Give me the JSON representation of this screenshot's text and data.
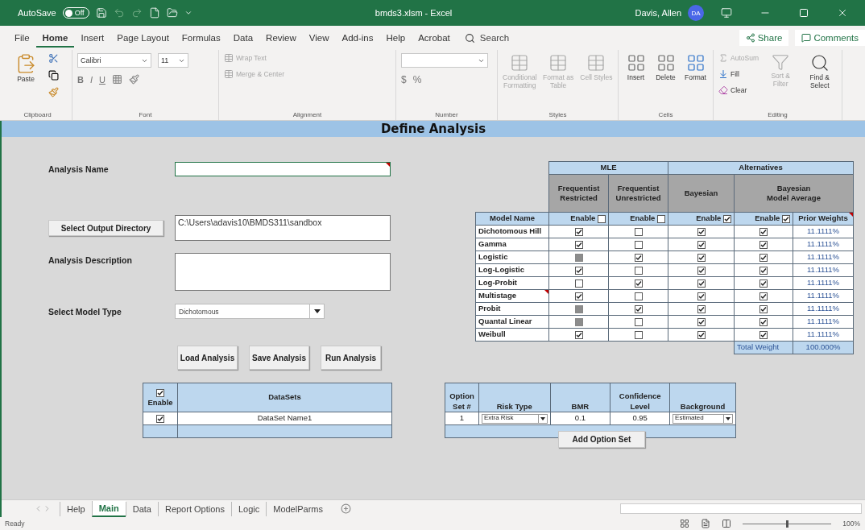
{
  "title_bar": {
    "autosave_label": "AutoSave",
    "autosave_state": "Off",
    "autosave_on": false,
    "file_name": "bmds3.xlsm - Excel",
    "user_name": "Davis, Allen",
    "user_initials": "DA"
  },
  "menu_tabs": [
    {
      "label": "File",
      "selected": false
    },
    {
      "label": "Home",
      "selected": true
    },
    {
      "label": "Insert",
      "selected": false
    },
    {
      "label": "Page Layout",
      "selected": false
    },
    {
      "label": "Formulas",
      "selected": false
    },
    {
      "label": "Data",
      "selected": false
    },
    {
      "label": "Review",
      "selected": false
    },
    {
      "label": "View",
      "selected": false
    },
    {
      "label": "Add-ins",
      "selected": false
    },
    {
      "label": "Help",
      "selected": false
    },
    {
      "label": "Acrobat",
      "selected": false
    }
  ],
  "search": {
    "placeholder": "Search"
  },
  "share": "Share",
  "comments": "Comments",
  "ribbon": {
    "clipboard": {
      "label": "Clipboard",
      "paste": "Paste"
    },
    "font": {
      "label": "Font",
      "font_name": "Calibri",
      "font_size": "11",
      "format_buttons": [
        "B",
        "I",
        "U"
      ]
    },
    "alignment": {
      "label": "Alignment",
      "items": [
        {
          "label": "Wrap Text",
          "disabled": true
        },
        {
          "label": "Merge & Center",
          "disabled": true
        }
      ]
    },
    "number": {
      "label": "Number",
      "symbols": [
        "$",
        "%"
      ]
    },
    "styles": {
      "label": "Styles",
      "items": [
        {
          "label": "Conditional Formatting",
          "disabled": true
        },
        {
          "label": "Format as Table",
          "disabled": true
        },
        {
          "label": "Cell Styles",
          "disabled": true
        }
      ]
    },
    "cells": {
      "label": "Cells",
      "items": [
        "Insert",
        "Delete",
        "Format"
      ]
    },
    "editing": {
      "label": "Editing",
      "items": [
        {
          "label": "AutoSum",
          "disabled": true
        },
        {
          "label": "Fill",
          "disabled": false
        },
        {
          "label": "Clear",
          "disabled": false
        }
      ],
      "large_items": [
        {
          "label": "Sort & Filter",
          "disabled": true
        },
        {
          "label": "Find & Select",
          "disabled": false
        }
      ]
    }
  },
  "sheet": {
    "header": "Define Analysis",
    "analysis_name_label": "Analysis Name",
    "output_button": "Select Output Directory",
    "output_path": "C:\\Users\\adavis10\\BMDS311\\sandbox",
    "description_label": "Analysis Description",
    "model_type_label": "Select Model Type",
    "model_type_value": "Dichotomous",
    "actions": [
      "Load Analysis",
      "Save Analysis",
      "Run Analysis"
    ],
    "models": {
      "groups": [
        "MLE",
        "Alternatives"
      ],
      "methods": [
        "Frequentist\nRestricted",
        "Frequentist\nUnrestricted",
        "Bayesian",
        "Bayesian\nModel Average"
      ],
      "name_header": "Model Name",
      "enable_headers": [
        {
          "label": "Enable",
          "checked": false
        },
        {
          "label": "Enable",
          "checked": false
        },
        {
          "label": "Enable",
          "checked": true
        },
        {
          "label": "Enable",
          "checked": true
        }
      ],
      "weights_header": "Prior Weights",
      "weights_comment": true,
      "rows": [
        {
          "name": "Dichotomous Hill",
          "comment": false,
          "cells": [
            {
              "checked": true,
              "disabled": false
            },
            {
              "checked": false,
              "disabled": false
            },
            {
              "checked": true,
              "disabled": false
            },
            {
              "checked": true,
              "disabled": false
            }
          ],
          "weight": "11.1111%"
        },
        {
          "name": "Gamma",
          "comment": false,
          "cells": [
            {
              "checked": true,
              "disabled": false
            },
            {
              "checked": false,
              "disabled": false
            },
            {
              "checked": true,
              "disabled": false
            },
            {
              "checked": true,
              "disabled": false
            }
          ],
          "weight": "11.1111%"
        },
        {
          "name": "Logistic",
          "comment": false,
          "cells": [
            {
              "checked": false,
              "disabled": true
            },
            {
              "checked": true,
              "disabled": false
            },
            {
              "checked": true,
              "disabled": false
            },
            {
              "checked": true,
              "disabled": false
            }
          ],
          "weight": "11.1111%"
        },
        {
          "name": "Log-Logistic",
          "comment": false,
          "cells": [
            {
              "checked": true,
              "disabled": false
            },
            {
              "checked": false,
              "disabled": false
            },
            {
              "checked": true,
              "disabled": false
            },
            {
              "checked": true,
              "disabled": false
            }
          ],
          "weight": "11.1111%"
        },
        {
          "name": "Log-Probit",
          "comment": false,
          "cells": [
            {
              "checked": false,
              "disabled": false
            },
            {
              "checked": true,
              "disabled": false
            },
            {
              "checked": true,
              "disabled": false
            },
            {
              "checked": true,
              "disabled": false
            }
          ],
          "weight": "11.1111%"
        },
        {
          "name": "Multistage",
          "comment": true,
          "cells": [
            {
              "checked": true,
              "disabled": false
            },
            {
              "checked": false,
              "disabled": false
            },
            {
              "checked": true,
              "disabled": false
            },
            {
              "checked": true,
              "disabled": false
            }
          ],
          "weight": "11.1111%"
        },
        {
          "name": "Probit",
          "comment": false,
          "cells": [
            {
              "checked": false,
              "disabled": true
            },
            {
              "checked": true,
              "disabled": false
            },
            {
              "checked": true,
              "disabled": false
            },
            {
              "checked": true,
              "disabled": false
            }
          ],
          "weight": "11.1111%"
        },
        {
          "name": "Quantal Linear",
          "comment": false,
          "cells": [
            {
              "checked": false,
              "disabled": true
            },
            {
              "checked": false,
              "disabled": false
            },
            {
              "checked": true,
              "disabled": false
            },
            {
              "checked": true,
              "disabled": false
            }
          ],
          "weight": "11.1111%"
        },
        {
          "name": "Weibull",
          "comment": false,
          "cells": [
            {
              "checked": true,
              "disabled": false
            },
            {
              "checked": false,
              "disabled": false
            },
            {
              "checked": true,
              "disabled": false
            },
            {
              "checked": true,
              "disabled": false
            }
          ],
          "weight": "11.1111%"
        }
      ],
      "total_label": "Total Weight",
      "total_value": "100.000%"
    },
    "datasets": {
      "enable_label": "Enable",
      "enable_all": true,
      "header": "DataSets",
      "rows": [
        {
          "enabled": true,
          "name": "DataSet Name1"
        }
      ]
    },
    "options": {
      "columns": [
        "Option\nSet #",
        "Risk Type",
        "BMR",
        "Confidence\nLevel",
        "Background"
      ],
      "rows": [
        {
          "set": "1",
          "risk_type": "Extra Risk",
          "bmr": "0.1",
          "confidence": "0.95",
          "background": "Estimated"
        }
      ],
      "add_button": "Add Option Set"
    }
  },
  "sheet_tabs": [
    {
      "label": "Help",
      "selected": false
    },
    {
      "label": "Main",
      "selected": true
    },
    {
      "label": "Data",
      "selected": false
    },
    {
      "label": "Report Options",
      "selected": false
    },
    {
      "label": "Logic",
      "selected": false
    },
    {
      "label": "ModelParms",
      "selected": false
    }
  ],
  "status_bar": {
    "status": "Ready",
    "zoom_slider": {
      "level": 0.5
    },
    "zoom": "100%"
  }
}
